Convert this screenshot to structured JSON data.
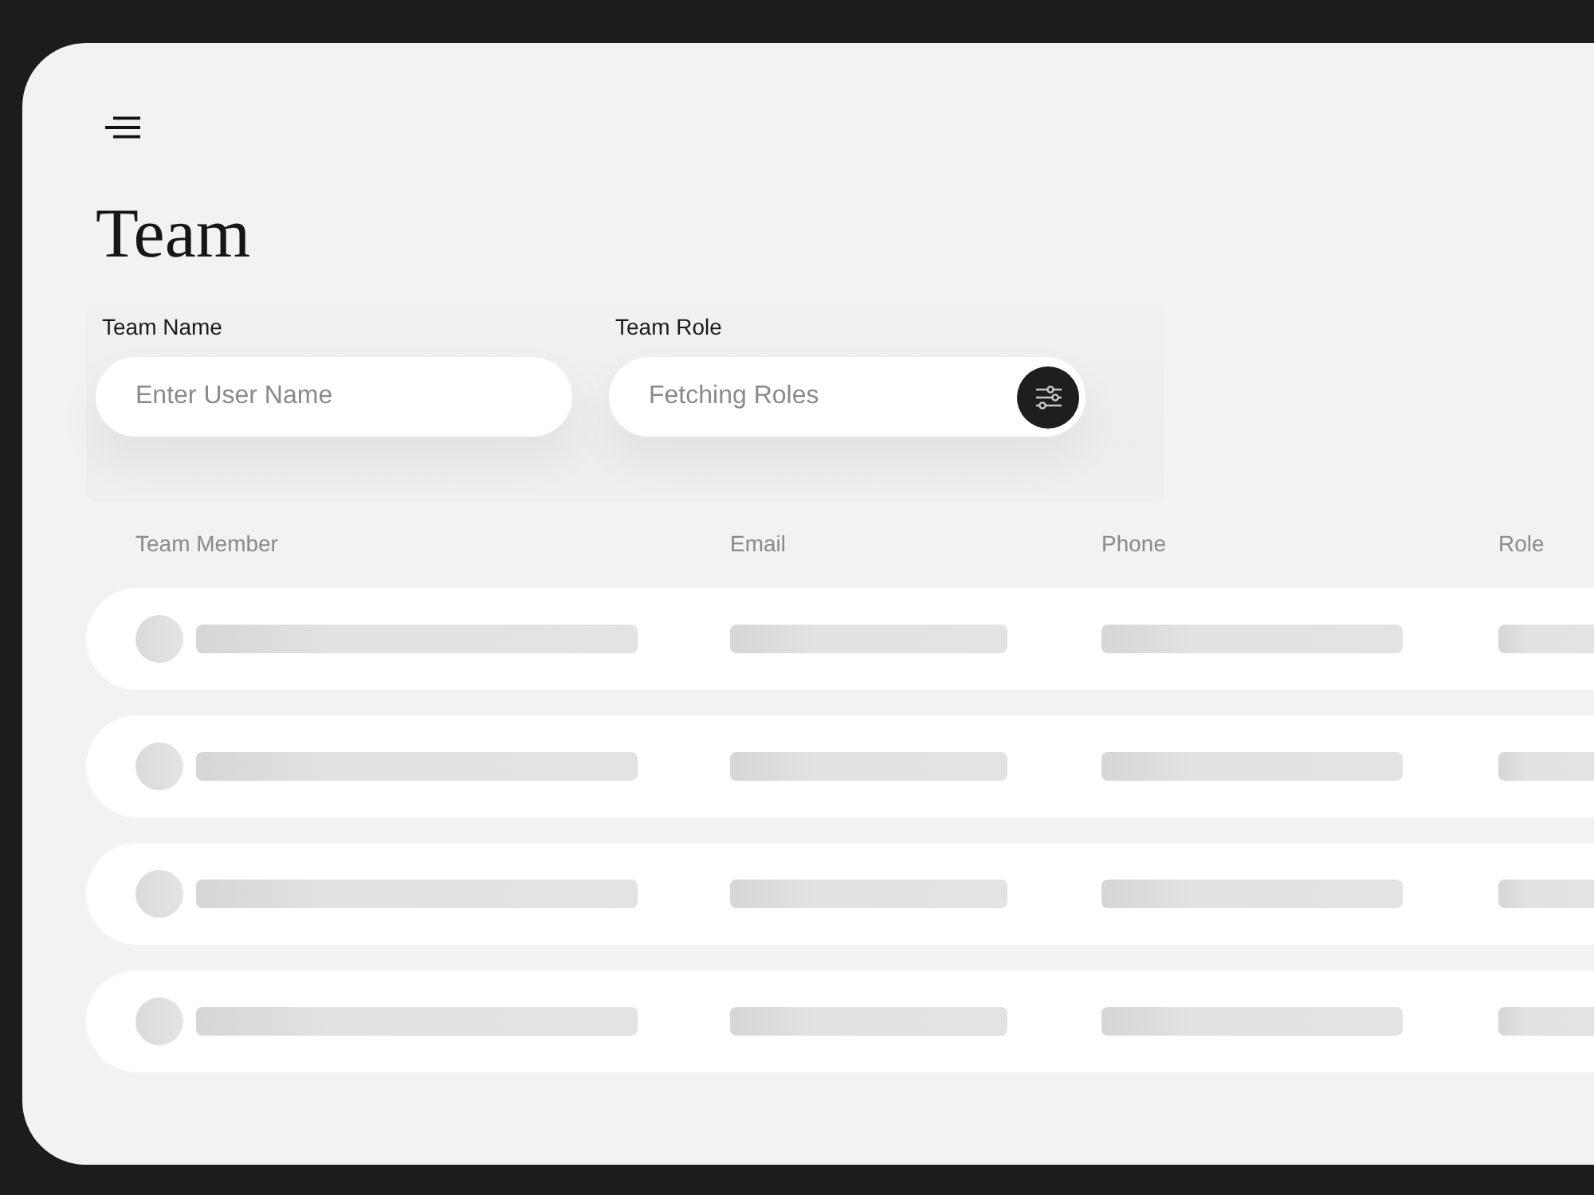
{
  "title": "Team",
  "filters": [
    {
      "kind": "text",
      "label": "Team Name",
      "placeholder": "Enter User Name"
    },
    {
      "kind": "select",
      "label": "Team Role",
      "placeholder": "Fetching Roles"
    }
  ],
  "table": {
    "columns": [
      "Team Member",
      "Email",
      "Phone",
      "Role"
    ],
    "rows": [
      {
        "kind": "skeleton"
      },
      {
        "kind": "skeleton"
      },
      {
        "kind": "skeleton"
      },
      {
        "kind": "skeleton"
      }
    ]
  }
}
